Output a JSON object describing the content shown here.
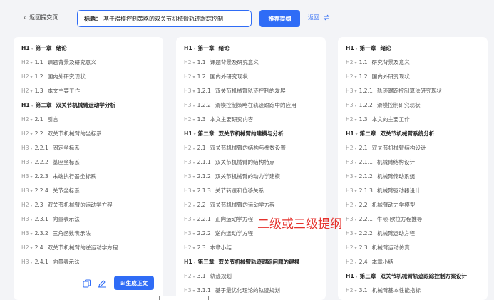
{
  "header": {
    "back_label": "返回提交页",
    "title_label": "标题：",
    "title_value": "基于滑模控制策略的双关节机械臂轨迹跟踪控制",
    "recommend_button": "推荐提纲",
    "back_link": "返回"
  },
  "columns": [
    {
      "items": [
        {
          "level": "H1",
          "num": "第一章",
          "text": "绪论",
          "h": "h1"
        },
        {
          "level": "H2",
          "num": "1.1",
          "text": "课题背景及研究意义",
          "h": "h2"
        },
        {
          "level": "H2",
          "num": "1.2",
          "text": "国内外研究现状",
          "h": "h2"
        },
        {
          "level": "H2",
          "num": "1.3",
          "text": "本文主要工作",
          "h": "h2"
        },
        {
          "level": "H1",
          "num": "第二章",
          "text": "双关节机械臂运动学分析",
          "h": "h1"
        },
        {
          "level": "H2",
          "num": "2.1",
          "text": "引言",
          "h": "h2"
        },
        {
          "level": "H2",
          "num": "2.2",
          "text": "双关节机械臂的坐标系",
          "h": "h2"
        },
        {
          "level": "H3",
          "num": "2.2.1",
          "text": "固定坐标系",
          "h": "h3"
        },
        {
          "level": "H3",
          "num": "2.2.2",
          "text": "基座坐标系",
          "h": "h3"
        },
        {
          "level": "H3",
          "num": "2.2.3",
          "text": "末端执行器坐标系",
          "h": "h3"
        },
        {
          "level": "H3",
          "num": "2.2.4",
          "text": "关节坐标系",
          "h": "h3"
        },
        {
          "level": "H2",
          "num": "2.3",
          "text": "双关节机械臂的运动学方程",
          "h": "h2"
        },
        {
          "level": "H3",
          "num": "2.3.1",
          "text": "向量表示法",
          "h": "h3"
        },
        {
          "level": "H3",
          "num": "2.3.2",
          "text": "三角函数表示法",
          "h": "h3"
        },
        {
          "level": "H2",
          "num": "2.4",
          "text": "双关节机械臂的逆运动学方程",
          "h": "h2"
        },
        {
          "level": "H3",
          "num": "2.4.1",
          "text": "向量表示法",
          "h": "h3"
        }
      ]
    },
    {
      "items": [
        {
          "level": "H1",
          "num": "第一章",
          "text": "绪论",
          "h": "h1"
        },
        {
          "level": "H2",
          "num": "1.1",
          "text": "课题背景及研究意义",
          "h": "h2"
        },
        {
          "level": "H2",
          "num": "1.2",
          "text": "国内外研究现状",
          "h": "h2"
        },
        {
          "level": "H3",
          "num": "1.2.1",
          "text": "双关节机械臂轨迹控制的发展",
          "h": "h3"
        },
        {
          "level": "H3",
          "num": "1.2.2",
          "text": "滑模控制策略在轨迹跟踪中的应用",
          "h": "h3"
        },
        {
          "level": "H2",
          "num": "1.3",
          "text": "本文主要研究内容",
          "h": "h2"
        },
        {
          "level": "H1",
          "num": "第二章",
          "text": "双关节机械臂的建模与分析",
          "h": "h1"
        },
        {
          "level": "H2",
          "num": "2.1",
          "text": "双关节机械臂的结构与参数设置",
          "h": "h2"
        },
        {
          "level": "H3",
          "num": "2.1.1",
          "text": "双关节机械臂的结构特点",
          "h": "h3"
        },
        {
          "level": "H3",
          "num": "2.1.2",
          "text": "双关节机械臂的动力学建模",
          "h": "h3"
        },
        {
          "level": "H3",
          "num": "2.1.3",
          "text": "关节转速和位移关系",
          "h": "h3"
        },
        {
          "level": "H2",
          "num": "2.2",
          "text": "双关节机械臂的运动学方程",
          "h": "h2"
        },
        {
          "level": "H3",
          "num": "2.2.1",
          "text": "正向运动学方程",
          "h": "h3"
        },
        {
          "level": "H3",
          "num": "2.2.2",
          "text": "逆向运动学方程",
          "h": "h3"
        },
        {
          "level": "H2",
          "num": "2.3",
          "text": "本章小结",
          "h": "h2"
        },
        {
          "level": "H1",
          "num": "第三章",
          "text": "双关节机械臂轨迹跟踪问题的建模",
          "h": "h1"
        },
        {
          "level": "H2",
          "num": "3.1",
          "text": "轨迹规划",
          "h": "h2"
        },
        {
          "level": "H3",
          "num": "3.1.1",
          "text": "基于最优化理论的轨迹规划",
          "h": "h3"
        }
      ]
    },
    {
      "items": [
        {
          "level": "H1",
          "num": "第一章",
          "text": "绪论",
          "h": "h1"
        },
        {
          "level": "H2",
          "num": "1.1",
          "text": "研究背景及意义",
          "h": "h2"
        },
        {
          "level": "H2",
          "num": "1.2",
          "text": "国内外研究现状",
          "h": "h2"
        },
        {
          "level": "H3",
          "num": "1.2.1",
          "text": "轨迹跟踪控制算法研究现状",
          "h": "h3"
        },
        {
          "level": "H3",
          "num": "1.2.2",
          "text": "滑模控制研究现状",
          "h": "h3"
        },
        {
          "level": "H2",
          "num": "1.3",
          "text": "本文的主要工作",
          "h": "h2"
        },
        {
          "level": "H1",
          "num": "第二章",
          "text": "双关节机械臂系统分析",
          "h": "h1"
        },
        {
          "level": "H2",
          "num": "2.1",
          "text": "双关节机械臂结构设计",
          "h": "h2"
        },
        {
          "level": "H3",
          "num": "2.1.1",
          "text": "机械臂结构设计",
          "h": "h3"
        },
        {
          "level": "H3",
          "num": "2.1.2",
          "text": "机械臂传动系统",
          "h": "h3"
        },
        {
          "level": "H3",
          "num": "2.1.3",
          "text": "机械臂驱动器设计",
          "h": "h3"
        },
        {
          "level": "H2",
          "num": "2.2",
          "text": "机械臂动力学模型",
          "h": "h2"
        },
        {
          "level": "H3",
          "num": "2.2.1",
          "text": "牛顿-欧拉方程推导",
          "h": "h3"
        },
        {
          "level": "H3",
          "num": "2.2.2",
          "text": "机械臂运动方程",
          "h": "h3"
        },
        {
          "level": "H2",
          "num": "2.3",
          "text": "机械臂运动仿真",
          "h": "h2"
        },
        {
          "level": "H2",
          "num": "2.4",
          "text": "本章小结",
          "h": "h2"
        },
        {
          "level": "H1",
          "num": "第三章",
          "text": "双关节机械臂轨迹跟踪控制方案设计",
          "h": "h1"
        },
        {
          "level": "H2",
          "num": "3.1",
          "text": "机械臂基本性能指标",
          "h": "h2"
        }
      ]
    }
  ],
  "actions": {
    "generate_button": "ai生成正文"
  },
  "annotation": "二级或三级提纲",
  "colors": {
    "accent": "#2f6cf6",
    "annotation": "#e5322d"
  }
}
